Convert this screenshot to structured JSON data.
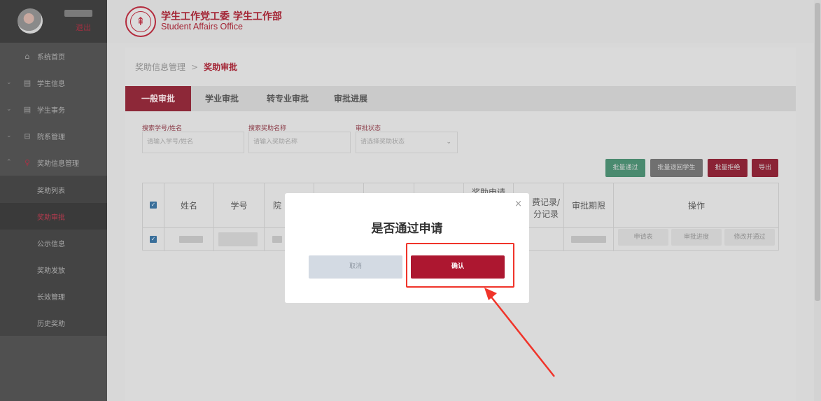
{
  "sidebar": {
    "logout": "退出",
    "items": [
      {
        "label": "系统首页",
        "icon": "home-icon",
        "glyph": "⌂"
      },
      {
        "label": "学生信息",
        "icon": "id-card-icon",
        "glyph": "▤"
      },
      {
        "label": "学生事务",
        "icon": "list-icon",
        "glyph": "▤"
      },
      {
        "label": "院系管理",
        "icon": "building-icon",
        "glyph": "⊟"
      },
      {
        "label": "奖助信息管理",
        "icon": "trophy-icon",
        "glyph": "♀"
      }
    ],
    "subitems": [
      {
        "label": "奖助列表"
      },
      {
        "label": "奖助审批"
      },
      {
        "label": "公示信息"
      },
      {
        "label": "奖助发放"
      },
      {
        "label": "长效管理"
      },
      {
        "label": "历史奖助"
      }
    ],
    "active_subitem": "奖助审批"
  },
  "header": {
    "title_cn": "学生工作党工委 学生工作部",
    "title_en": "Student Affairs Office"
  },
  "breadcrumb": {
    "parent": "奖助信息管理",
    "separator": ">",
    "current": "奖助审批"
  },
  "tabs": [
    {
      "label": "一般审批",
      "active": true
    },
    {
      "label": "学业审批"
    },
    {
      "label": "转专业审批"
    },
    {
      "label": "审批进展"
    }
  ],
  "filters": [
    {
      "label": "搜索学号/姓名",
      "placeholder": "请输入学号/姓名"
    },
    {
      "label": "搜索奖助名称",
      "placeholder": "请输入奖助名称"
    },
    {
      "label": "审批状态",
      "placeholder": "请选择奖助状态"
    }
  ],
  "actions": {
    "batch_pass": "批量通过",
    "batch_return": "批量退回学生",
    "batch_reject": "批量拒绝",
    "export": "导出"
  },
  "table": {
    "headers": {
      "name": "姓名",
      "student_id": "学号",
      "col_partial": "院",
      "apply_line1": "奖助申请",
      "record_line1": "费记录/",
      "record_line2": "分记录",
      "deadline": "审批期限",
      "operations": "操作"
    },
    "row_actions": [
      "申请表",
      "审批进度",
      "修改并通过"
    ]
  },
  "modal": {
    "title": "是否通过申请",
    "cancel": "取消",
    "confirm": "确认",
    "close": "×"
  },
  "colors": {
    "brand_red": "#ad1730",
    "highlight": "#f0342a"
  }
}
